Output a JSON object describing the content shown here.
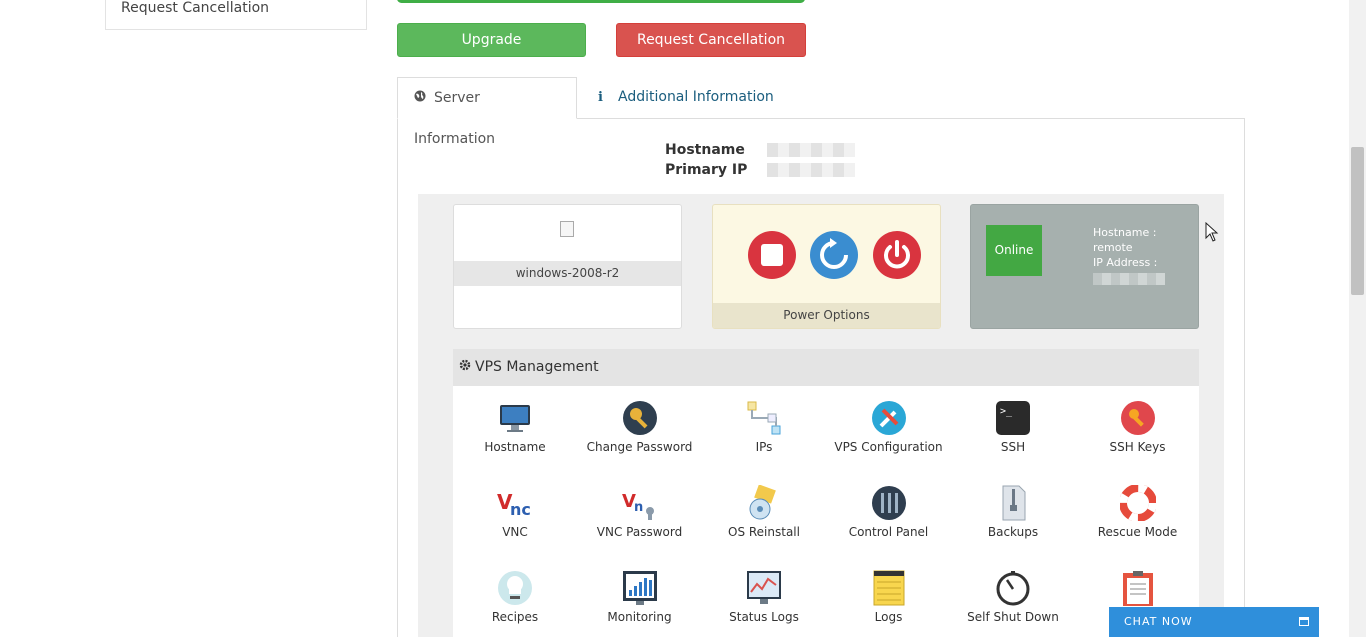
{
  "sidebar": {
    "item_label": "Request Cancellation"
  },
  "actions": {
    "upgrade_label": "Upgrade",
    "cancel_label": "Request Cancellation"
  },
  "tabs": [
    {
      "label": "Server Information",
      "icon": "globe-icon",
      "active": true
    },
    {
      "label": "Additional Information",
      "icon": "info-icon",
      "active": false
    }
  ],
  "host_info": {
    "hostname_label": "Hostname",
    "primary_ip_label": "Primary IP"
  },
  "os_card": {
    "os_name": "windows-2008-r2"
  },
  "power_card": {
    "label": "Power Options",
    "buttons": [
      "stop-icon",
      "restart-icon",
      "power-off-icon"
    ]
  },
  "status_card": {
    "status": "Online",
    "hostname_label": "Hostname :",
    "hostname_value": "remote",
    "ip_label": "IP Address :"
  },
  "vps_management": {
    "title": "VPS Management",
    "tools": [
      {
        "label": "Hostname",
        "icon": "monitor-icon"
      },
      {
        "label": "Change Password",
        "icon": "key-icon"
      },
      {
        "label": "IPs",
        "icon": "network-icon"
      },
      {
        "label": "VPS Configuration",
        "icon": "tools-icon"
      },
      {
        "label": "SSH",
        "icon": "terminal-icon"
      },
      {
        "label": "SSH Keys",
        "icon": "ssh-key-icon"
      },
      {
        "label": "VNC",
        "icon": "vnc-icon"
      },
      {
        "label": "VNC Password",
        "icon": "vnc-password-icon"
      },
      {
        "label": "OS Reinstall",
        "icon": "os-reinstall-icon"
      },
      {
        "label": "Control Panel",
        "icon": "control-panel-icon"
      },
      {
        "label": "Backups",
        "icon": "archive-icon"
      },
      {
        "label": "Rescue Mode",
        "icon": "lifebuoy-icon"
      },
      {
        "label": "Recipes",
        "icon": "chef-icon"
      },
      {
        "label": "Monitoring",
        "icon": "chart-icon"
      },
      {
        "label": "Status Logs",
        "icon": "status-chart-icon"
      },
      {
        "label": "Logs",
        "icon": "notepad-icon"
      },
      {
        "label": "Self Shut Down",
        "icon": "timer-icon"
      },
      {
        "label": "",
        "icon": "clipboard-icon"
      }
    ]
  },
  "chat": {
    "label": "CHAT NOW"
  },
  "colors": {
    "green": "#5cb85c",
    "red": "#d9534f",
    "online": "#43a843",
    "chat": "#2f8fdb"
  }
}
